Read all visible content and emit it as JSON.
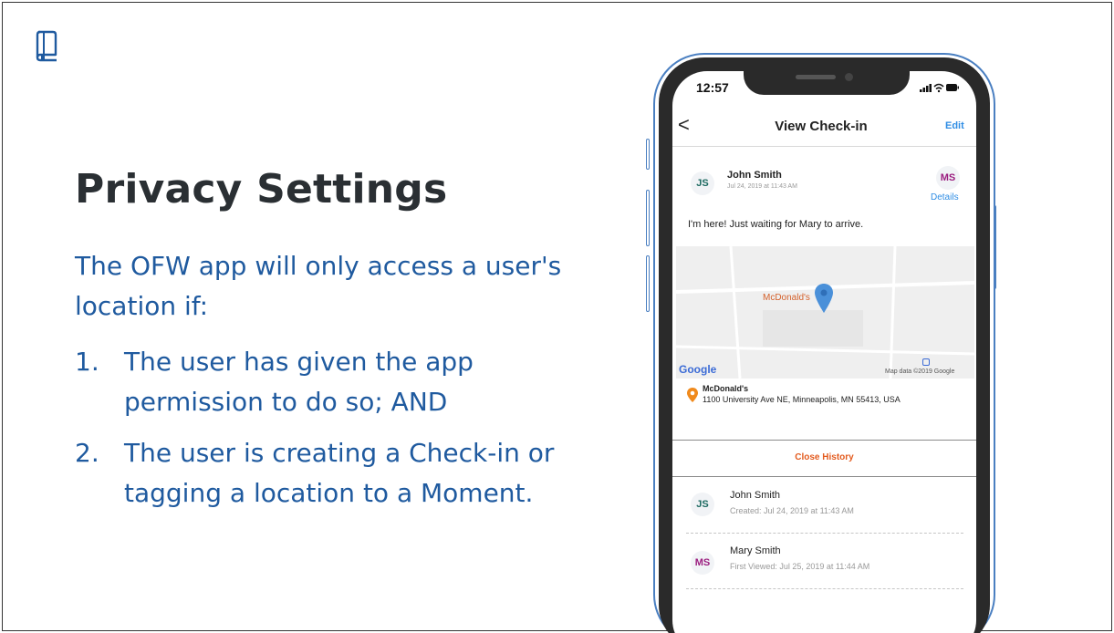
{
  "slide": {
    "title": "Privacy Settings",
    "intro": "The OFW app will only access a user's location if:",
    "items": [
      {
        "num": "1.",
        "text": "The user has given the app permission to do so; AND"
      },
      {
        "num": "2.",
        "text": "The user is creating a Check-in or tagging a location to a Moment."
      }
    ],
    "logo_icon": "book-icon"
  },
  "phone": {
    "status": {
      "time": "12:57",
      "icons": "..ıl ᯤ ▬"
    },
    "nav": {
      "back": "<",
      "title": "View Check-in",
      "edit": "Edit"
    },
    "checkin": {
      "author_initials": "JS",
      "author_name": "John Smith",
      "timestamp": "Jul 24, 2019 at 11:43 AM",
      "recipient_initials": "MS",
      "details": "Details",
      "message": "I'm here!  Just waiting for Mary to arrive."
    },
    "map": {
      "place_label": "McDonald's",
      "google": "Google",
      "attribution": "Map data ©2019 Google"
    },
    "place": {
      "name": "McDonald's",
      "address": "1100 University Ave NE, Minneapolis, MN 55413, USA"
    },
    "close_history": "Close History",
    "history": [
      {
        "initials": "JS",
        "name": "John Smith",
        "meta": "Created: Jul 24, 2019 at 11:43 AM"
      },
      {
        "initials": "MS",
        "name": "Mary Smith",
        "meta": "First Viewed: Jul 25, 2019 at 11:44 AM"
      }
    ]
  },
  "colors": {
    "accent_blue": "#1f5a9f",
    "link_blue": "#2f8de4",
    "close_orange": "#e35b1e"
  }
}
